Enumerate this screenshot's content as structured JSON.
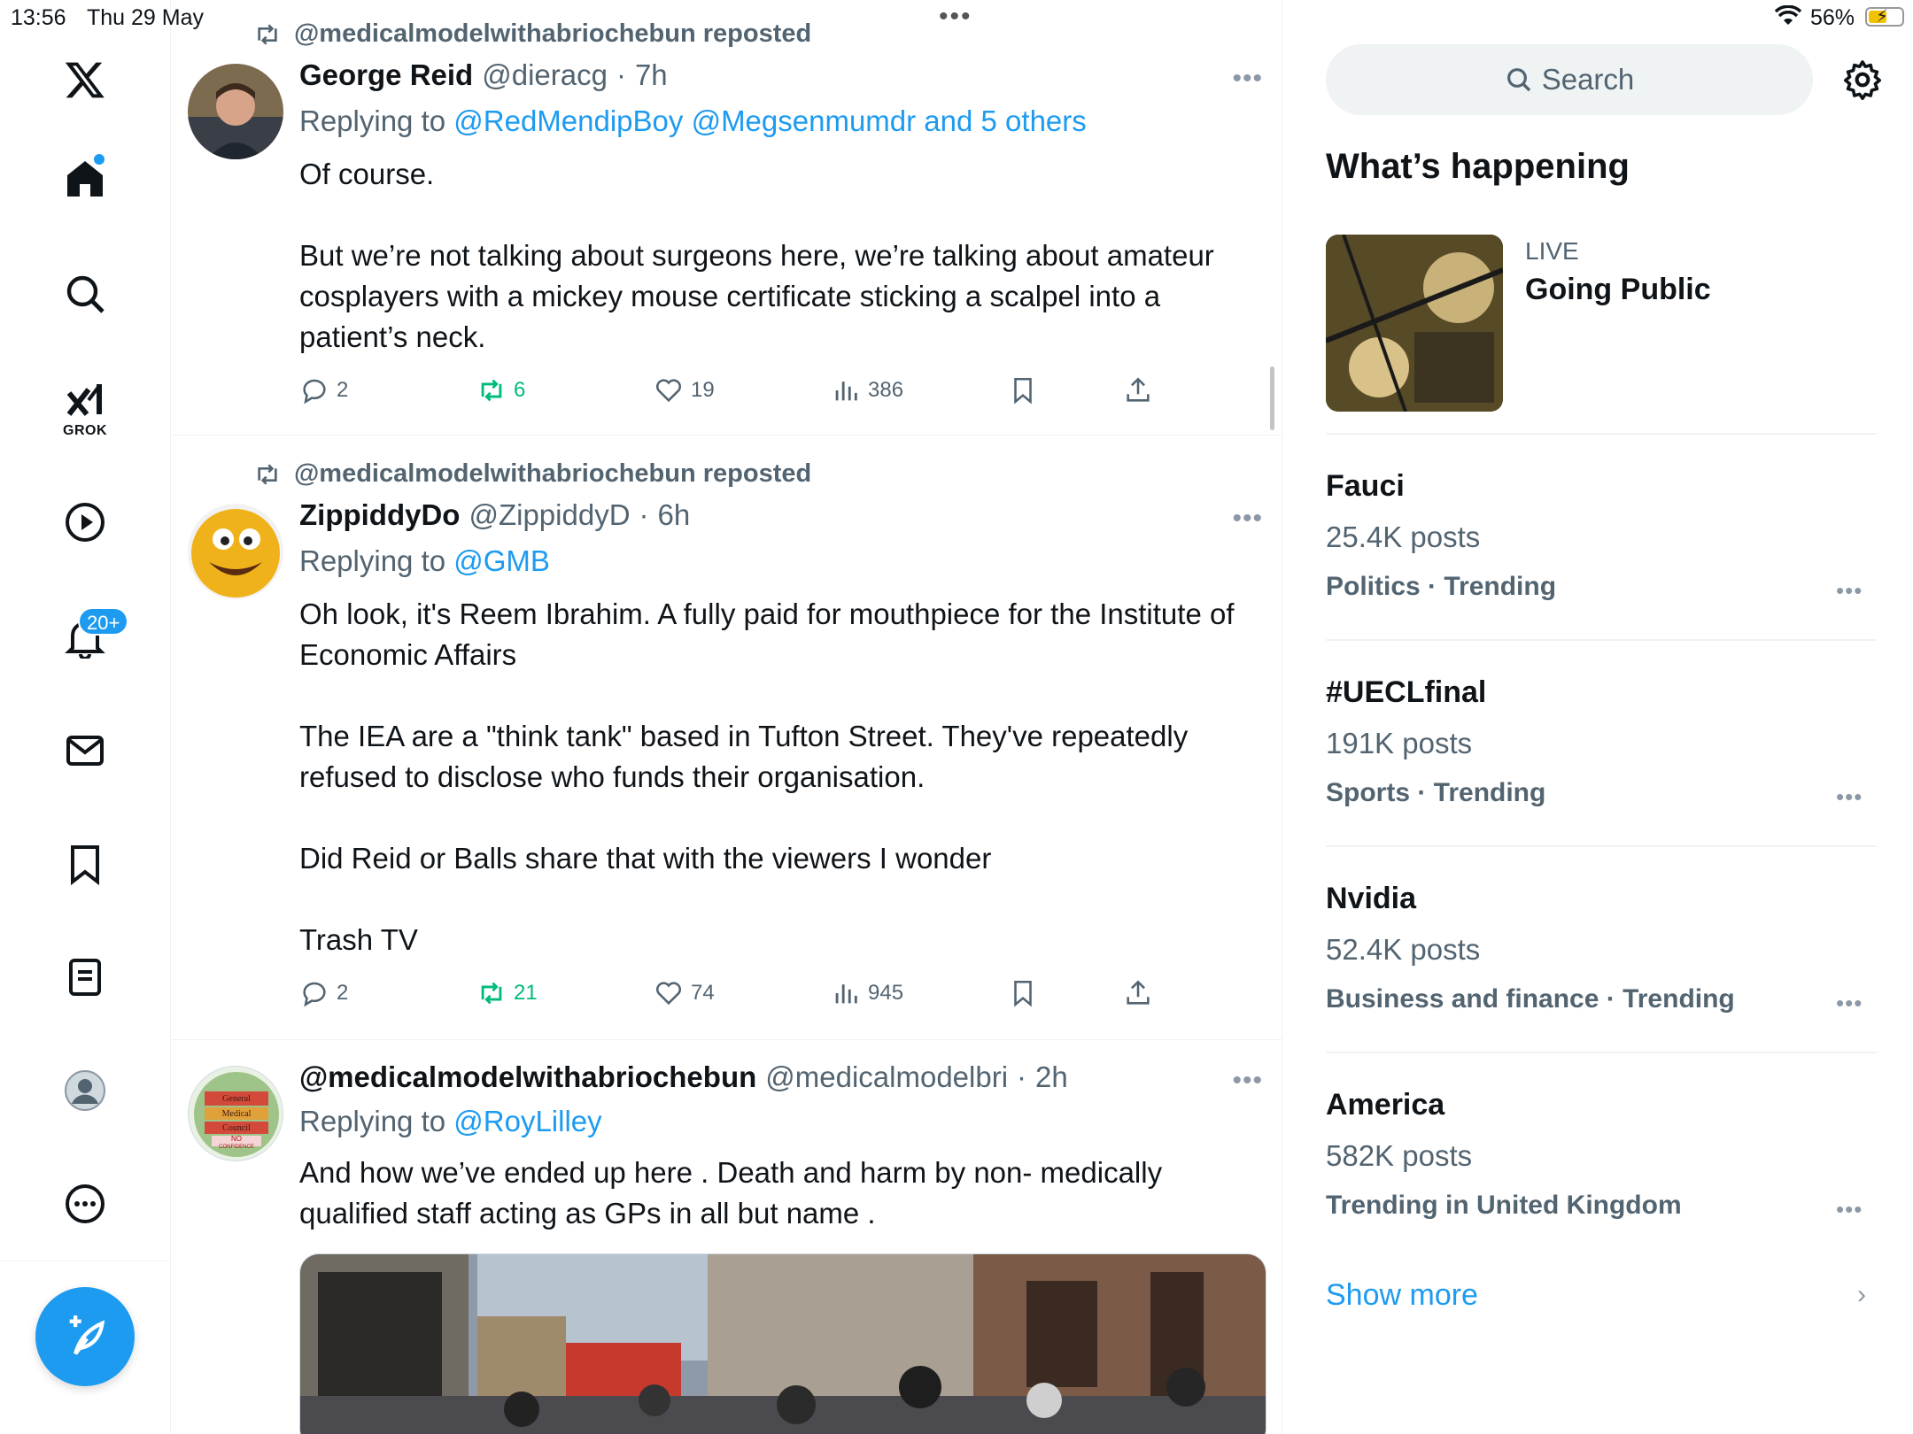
{
  "status": {
    "time": "13:56",
    "date": "Thu 29 May",
    "battery": "56%",
    "battery_level": 0.56
  },
  "nav": {
    "grok_label": "GROK",
    "notifications_badge": "20+"
  },
  "posts": [
    {
      "repost_by": "@medicalmodelwithabriochebun reposted",
      "name": "George Reid",
      "handle": "@dieracg",
      "time": "7h",
      "replying_prefix": "Replying to ",
      "replying_to": "@RedMendipBoy @Megsenmumdr and 5 others",
      "text": [
        "Of course.",
        "",
        "But we’re not talking about surgeons here, we’re talking about amateur cosplayers with a mickey mouse certificate sticking a scalpel into a patient’s neck."
      ],
      "replies": "2",
      "reposts": "6",
      "likes": "19",
      "views": "386"
    },
    {
      "repost_by": "@medicalmodelwithabriochebun reposted",
      "name": "ZippiddyDo",
      "handle": "@ZippiddyD",
      "time": "6h",
      "replying_prefix": "Replying to ",
      "replying_to": "@GMB",
      "text": [
        "Oh look, it's Reem Ibrahim. A fully paid for mouthpiece for the Institute of Economic Affairs",
        "",
        "The IEA are a \"think tank\" based in Tufton Street. They've repeatedly refused to disclose who funds their organisation.",
        "",
        "Did Reid or Balls share that with the viewers I wonder",
        "",
        "Trash TV"
      ],
      "replies": "2",
      "reposts": "21",
      "likes": "74",
      "views": "945"
    },
    {
      "name": "@medicalmodelwithabriochebun",
      "handle": "@medicalmodelbri",
      "time": "2h",
      "replying_prefix": "Replying to ",
      "replying_to": "@RoyLilley",
      "text": [
        "And how we’ve ended up here . Death and harm by non- medically qualified staff acting as GPs in all but name ."
      ],
      "avatar_text": [
        "General",
        "Medical",
        "Council",
        "NO",
        "CONFIDENCE"
      ]
    }
  ],
  "right": {
    "search_placeholder": "Search",
    "section_title": "What’s happening",
    "live": {
      "tag": "LIVE",
      "title": "Going Public"
    },
    "trends": [
      {
        "topic": "Fauci",
        "count": "25.4K posts",
        "category": "Politics · Trending"
      },
      {
        "topic": "#UECLfinal",
        "count": "191K posts",
        "category": "Sports · Trending"
      },
      {
        "topic": "Nvidia",
        "count": "52.4K posts",
        "category": "Business and finance · Trending"
      },
      {
        "topic": "America",
        "count": "582K posts",
        "category": "Trending in United Kingdom"
      }
    ],
    "show_more": "Show more"
  },
  "colors": {
    "accent": "#1d9bf0",
    "repost_green": "#00ba7c",
    "muted": "#536471"
  }
}
